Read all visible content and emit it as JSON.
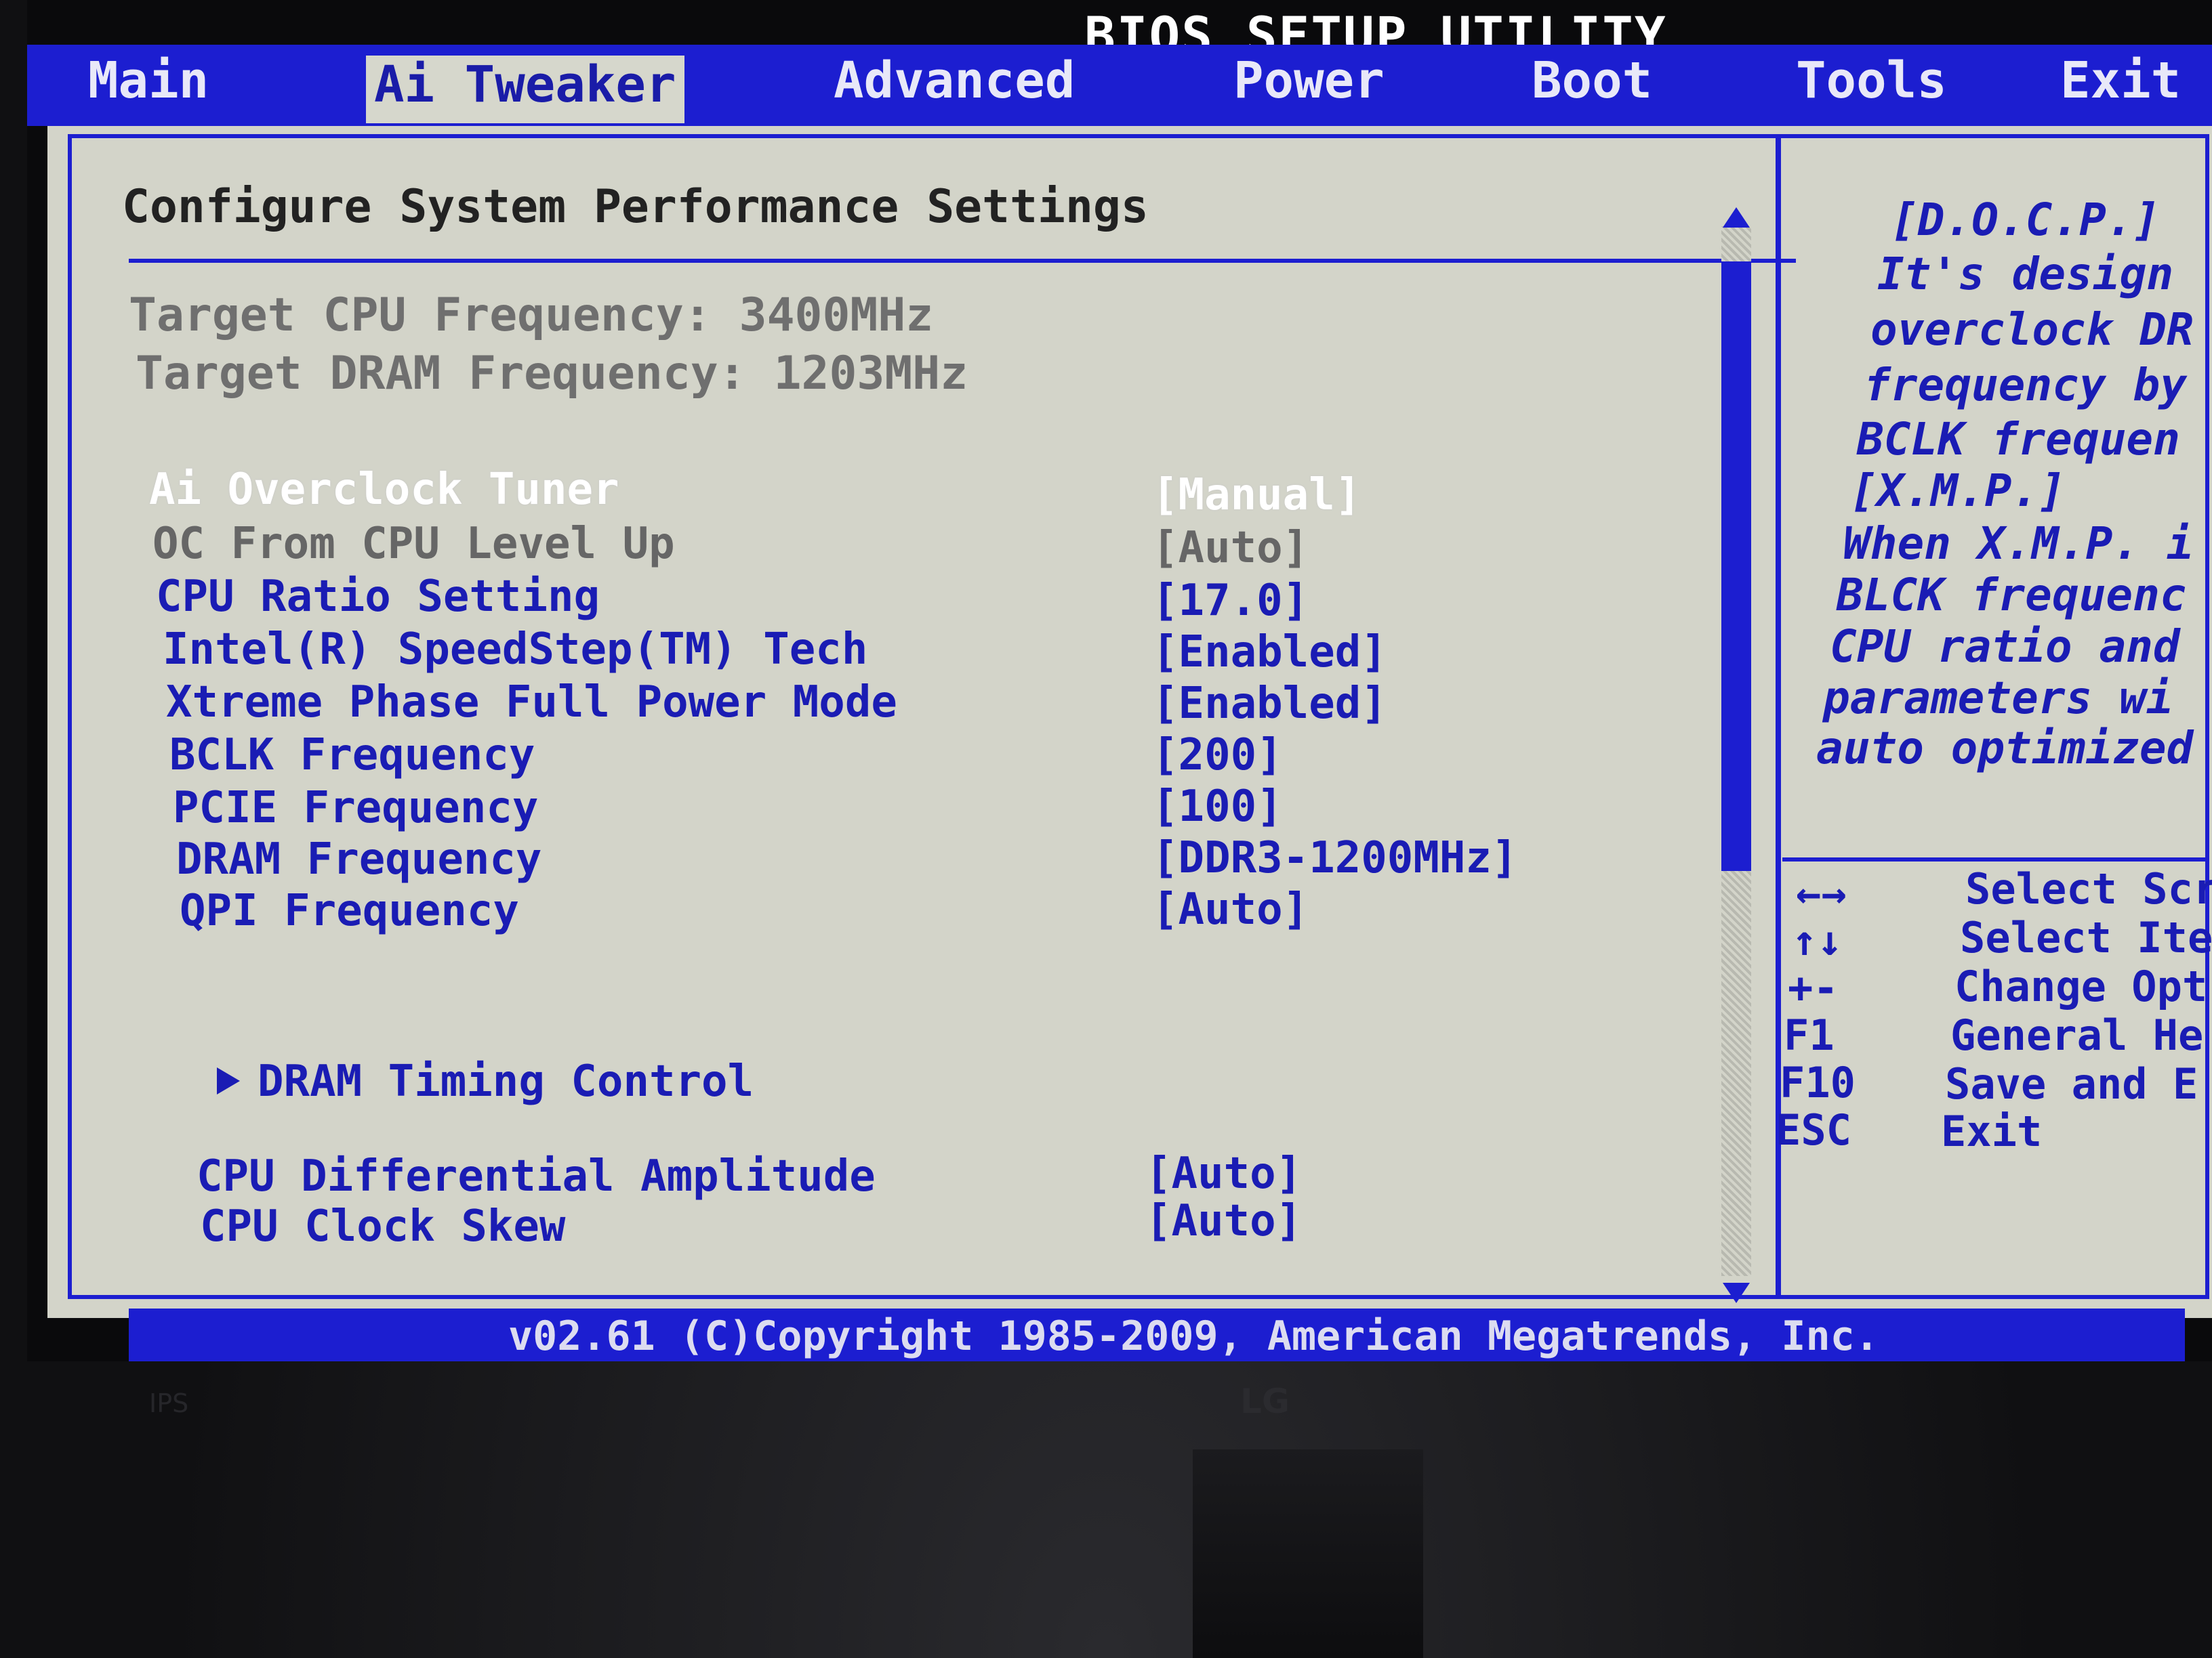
{
  "header": {
    "title": "BIOS SETUP UTILITY"
  },
  "menu": {
    "tabs": [
      {
        "label": "Main"
      },
      {
        "label": "Ai Tweaker"
      },
      {
        "label": "Advanced"
      },
      {
        "label": "Power"
      },
      {
        "label": "Boot"
      },
      {
        "label": "Tools"
      },
      {
        "label": "Exit"
      }
    ],
    "active_tab": "Ai Tweaker"
  },
  "main": {
    "section_title": "Configure System Performance Settings",
    "info": [
      "Target CPU Frequency: 3400MHz",
      "Target DRAM Frequency: 1203MHz"
    ],
    "settings": [
      {
        "label": "Ai Overclock Tuner",
        "value": "[Manual]"
      },
      {
        "label": "OC From CPU Level Up",
        "value": "[Auto]"
      },
      {
        "label": "CPU Ratio Setting",
        "value": "[17.0]"
      },
      {
        "label": "Intel(R) SpeedStep(TM) Tech",
        "value": "[Enabled]"
      },
      {
        "label": "Xtreme Phase Full Power Mode",
        "value": "[Enabled]"
      },
      {
        "label": "BCLK Frequency",
        "value": "[200]"
      },
      {
        "label": "PCIE Frequency",
        "value": "[100]"
      },
      {
        "label": "DRAM Frequency",
        "value": "[DDR3-1200MHz]"
      },
      {
        "label": "QPI Frequency",
        "value": "[Auto]"
      }
    ],
    "submenu": {
      "label": "DRAM Timing Control"
    },
    "settings_lower": [
      {
        "label": "CPU Differential Amplitude",
        "value": "[Auto]"
      },
      {
        "label": "CPU Clock Skew",
        "value": "[Auto]"
      }
    ]
  },
  "help": {
    "lines": [
      "[D.O.C.P.]",
      "It's design",
      "overclock DR",
      "frequency by",
      "BCLK frequen",
      "[X.M.P.]",
      "When X.M.P. i",
      "BLCK frequenc",
      "CPU ratio and",
      "parameters wi",
      "auto optimized"
    ],
    "keys": [
      {
        "key": "←→",
        "desc": "Select Scr"
      },
      {
        "key": "↑↓",
        "desc": "Select Ite"
      },
      {
        "key": "+-",
        "desc": "Change Opt"
      },
      {
        "key": "F1",
        "desc": "General He"
      },
      {
        "key": "F10",
        "desc": "Save and E"
      },
      {
        "key": "ESC",
        "desc": "Exit"
      }
    ]
  },
  "footer": {
    "copyright": "v02.61 (C)Copyright 1985-2009, American Megatrends, Inc."
  },
  "monitor": {
    "brand": "LG",
    "badge": "IPS"
  },
  "colors": {
    "bios_blue": "#1c1ed0",
    "panel_bg": "#d3d4c9",
    "highlight_text": "#ffffff",
    "disabled_text": "#666666"
  }
}
